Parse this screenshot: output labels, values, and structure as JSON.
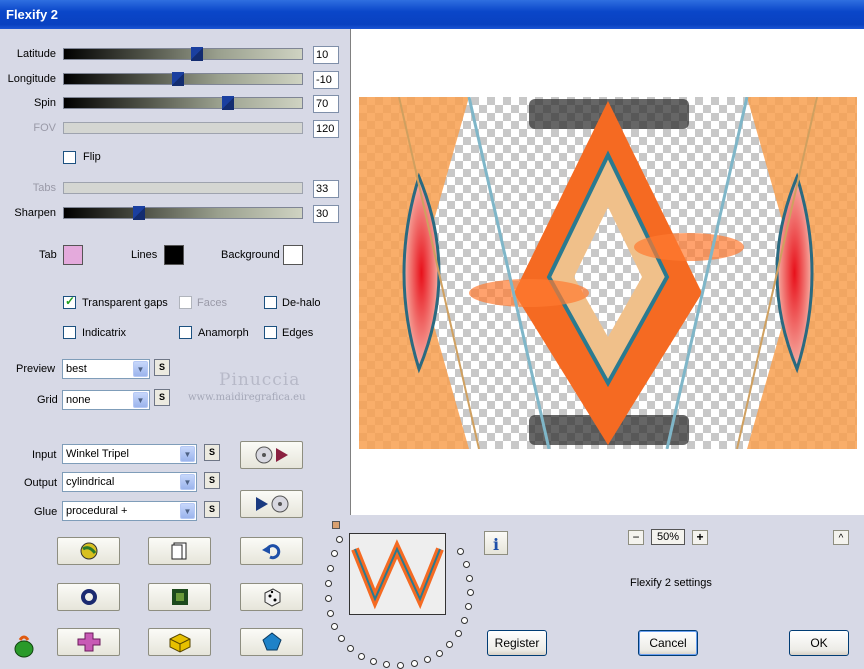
{
  "window": {
    "title": "Flexify 2"
  },
  "sliders": {
    "latitude": {
      "label": "Latitude",
      "value": "10",
      "fraction": 0.55
    },
    "longitude": {
      "label": "Longitude",
      "value": "-10",
      "fraction": 0.47
    },
    "spin": {
      "label": "Spin",
      "value": "70",
      "fraction": 0.69
    },
    "fov": {
      "label": "FOV",
      "value": "120"
    },
    "tabs": {
      "label": "Tabs",
      "value": "33"
    },
    "sharpen": {
      "label": "Sharpen",
      "value": "30",
      "fraction": 0.31
    }
  },
  "flip": {
    "label": "Flip",
    "checked": false
  },
  "colors": {
    "tab_label": "Tab",
    "tab_color": "#e4aadc",
    "lines_label": "Lines",
    "lines_color": "#000000",
    "background_label": "Background",
    "background_color": "#ffffff"
  },
  "options": {
    "transparent_gaps": "Transparent gaps",
    "faces": "Faces",
    "dehalo": "De-halo",
    "indicatrix": "Indicatrix",
    "anamorph": "Anamorph",
    "edges": "Edges"
  },
  "preview": {
    "label": "Preview",
    "value": "best"
  },
  "grid": {
    "label": "Grid",
    "value": "none"
  },
  "input": {
    "label": "Input",
    "value": "Winkel Tripel"
  },
  "output": {
    "label": "Output",
    "value": "cylindrical"
  },
  "glue": {
    "label": "Glue",
    "value": "procedural +"
  },
  "s_label": "S",
  "watermark": {
    "line1": "Pinuccia",
    "line2": "www.maidiregrafica.eu"
  },
  "zoom": {
    "value": "50%",
    "minus": "−",
    "plus": "+"
  },
  "caret": "^",
  "settings_label": "Flexify 2 settings",
  "buttons": {
    "register": "Register",
    "cancel": "Cancel",
    "ok": "OK"
  }
}
